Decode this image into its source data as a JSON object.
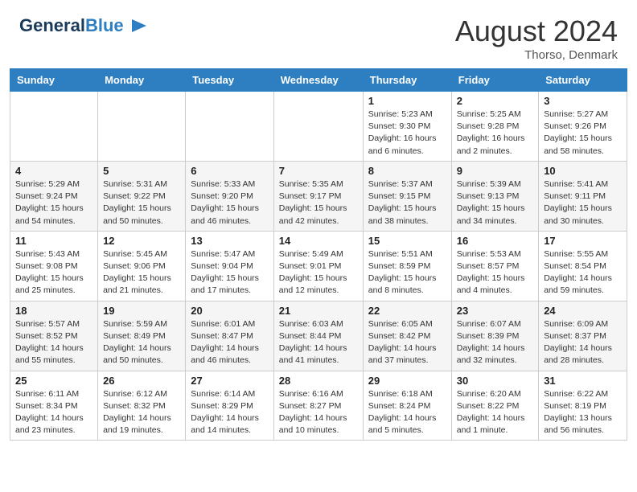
{
  "header": {
    "logo_line1": "General",
    "logo_line2": "Blue",
    "month_year": "August 2024",
    "location": "Thorso, Denmark"
  },
  "days_of_week": [
    "Sunday",
    "Monday",
    "Tuesday",
    "Wednesday",
    "Thursday",
    "Friday",
    "Saturday"
  ],
  "weeks": [
    [
      {
        "day": "",
        "info": ""
      },
      {
        "day": "",
        "info": ""
      },
      {
        "day": "",
        "info": ""
      },
      {
        "day": "",
        "info": ""
      },
      {
        "day": "1",
        "info": "Sunrise: 5:23 AM\nSunset: 9:30 PM\nDaylight: 16 hours\nand 6 minutes."
      },
      {
        "day": "2",
        "info": "Sunrise: 5:25 AM\nSunset: 9:28 PM\nDaylight: 16 hours\nand 2 minutes."
      },
      {
        "day": "3",
        "info": "Sunrise: 5:27 AM\nSunset: 9:26 PM\nDaylight: 15 hours\nand 58 minutes."
      }
    ],
    [
      {
        "day": "4",
        "info": "Sunrise: 5:29 AM\nSunset: 9:24 PM\nDaylight: 15 hours\nand 54 minutes."
      },
      {
        "day": "5",
        "info": "Sunrise: 5:31 AM\nSunset: 9:22 PM\nDaylight: 15 hours\nand 50 minutes."
      },
      {
        "day": "6",
        "info": "Sunrise: 5:33 AM\nSunset: 9:20 PM\nDaylight: 15 hours\nand 46 minutes."
      },
      {
        "day": "7",
        "info": "Sunrise: 5:35 AM\nSunset: 9:17 PM\nDaylight: 15 hours\nand 42 minutes."
      },
      {
        "day": "8",
        "info": "Sunrise: 5:37 AM\nSunset: 9:15 PM\nDaylight: 15 hours\nand 38 minutes."
      },
      {
        "day": "9",
        "info": "Sunrise: 5:39 AM\nSunset: 9:13 PM\nDaylight: 15 hours\nand 34 minutes."
      },
      {
        "day": "10",
        "info": "Sunrise: 5:41 AM\nSunset: 9:11 PM\nDaylight: 15 hours\nand 30 minutes."
      }
    ],
    [
      {
        "day": "11",
        "info": "Sunrise: 5:43 AM\nSunset: 9:08 PM\nDaylight: 15 hours\nand 25 minutes."
      },
      {
        "day": "12",
        "info": "Sunrise: 5:45 AM\nSunset: 9:06 PM\nDaylight: 15 hours\nand 21 minutes."
      },
      {
        "day": "13",
        "info": "Sunrise: 5:47 AM\nSunset: 9:04 PM\nDaylight: 15 hours\nand 17 minutes."
      },
      {
        "day": "14",
        "info": "Sunrise: 5:49 AM\nSunset: 9:01 PM\nDaylight: 15 hours\nand 12 minutes."
      },
      {
        "day": "15",
        "info": "Sunrise: 5:51 AM\nSunset: 8:59 PM\nDaylight: 15 hours\nand 8 minutes."
      },
      {
        "day": "16",
        "info": "Sunrise: 5:53 AM\nSunset: 8:57 PM\nDaylight: 15 hours\nand 4 minutes."
      },
      {
        "day": "17",
        "info": "Sunrise: 5:55 AM\nSunset: 8:54 PM\nDaylight: 14 hours\nand 59 minutes."
      }
    ],
    [
      {
        "day": "18",
        "info": "Sunrise: 5:57 AM\nSunset: 8:52 PM\nDaylight: 14 hours\nand 55 minutes."
      },
      {
        "day": "19",
        "info": "Sunrise: 5:59 AM\nSunset: 8:49 PM\nDaylight: 14 hours\nand 50 minutes."
      },
      {
        "day": "20",
        "info": "Sunrise: 6:01 AM\nSunset: 8:47 PM\nDaylight: 14 hours\nand 46 minutes."
      },
      {
        "day": "21",
        "info": "Sunrise: 6:03 AM\nSunset: 8:44 PM\nDaylight: 14 hours\nand 41 minutes."
      },
      {
        "day": "22",
        "info": "Sunrise: 6:05 AM\nSunset: 8:42 PM\nDaylight: 14 hours\nand 37 minutes."
      },
      {
        "day": "23",
        "info": "Sunrise: 6:07 AM\nSunset: 8:39 PM\nDaylight: 14 hours\nand 32 minutes."
      },
      {
        "day": "24",
        "info": "Sunrise: 6:09 AM\nSunset: 8:37 PM\nDaylight: 14 hours\nand 28 minutes."
      }
    ],
    [
      {
        "day": "25",
        "info": "Sunrise: 6:11 AM\nSunset: 8:34 PM\nDaylight: 14 hours\nand 23 minutes."
      },
      {
        "day": "26",
        "info": "Sunrise: 6:12 AM\nSunset: 8:32 PM\nDaylight: 14 hours\nand 19 minutes."
      },
      {
        "day": "27",
        "info": "Sunrise: 6:14 AM\nSunset: 8:29 PM\nDaylight: 14 hours\nand 14 minutes."
      },
      {
        "day": "28",
        "info": "Sunrise: 6:16 AM\nSunset: 8:27 PM\nDaylight: 14 hours\nand 10 minutes."
      },
      {
        "day": "29",
        "info": "Sunrise: 6:18 AM\nSunset: 8:24 PM\nDaylight: 14 hours\nand 5 minutes."
      },
      {
        "day": "30",
        "info": "Sunrise: 6:20 AM\nSunset: 8:22 PM\nDaylight: 14 hours\nand 1 minute."
      },
      {
        "day": "31",
        "info": "Sunrise: 6:22 AM\nSunset: 8:19 PM\nDaylight: 13 hours\nand 56 minutes."
      }
    ]
  ]
}
